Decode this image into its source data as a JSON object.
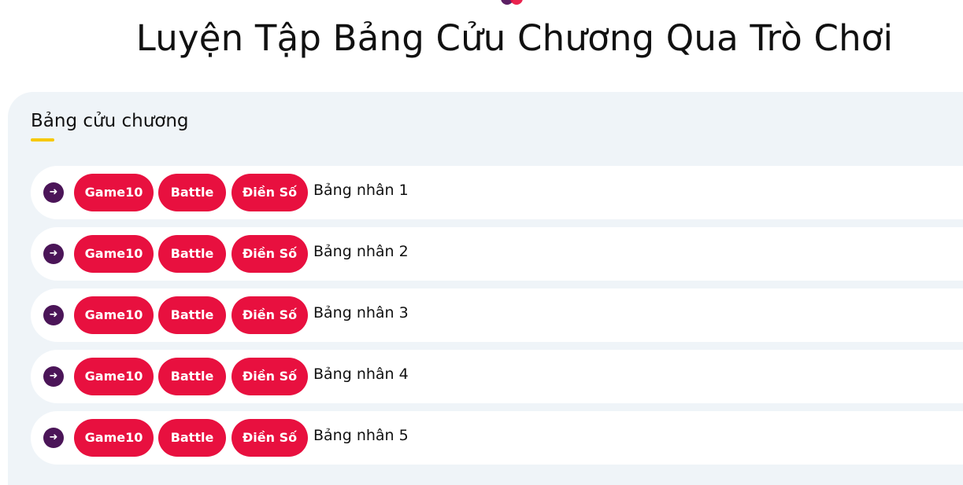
{
  "header": {
    "title": "Luyện Tập Bảng Cửu Chương Qua Trò Chơi"
  },
  "section": {
    "title": "Bảng cửu chương"
  },
  "rows": [
    {
      "game10": "Game10",
      "battle": "Battle",
      "dienso": "Điền Số",
      "label": "Bảng nhân 1"
    },
    {
      "game10": "Game10",
      "battle": "Battle",
      "dienso": "Điền Số",
      "label": "Bảng nhân 2"
    },
    {
      "game10": "Game10",
      "battle": "Battle",
      "dienso": "Điền Số",
      "label": "Bảng nhân 3"
    },
    {
      "game10": "Game10",
      "battle": "Battle",
      "dienso": "Điền Số",
      "label": "Bảng nhân 4"
    },
    {
      "game10": "Game10",
      "battle": "Battle",
      "dienso": "Điền Số",
      "label": "Bảng nhân 5"
    }
  ],
  "icons": {
    "row_arrow": "arrow-right-icon",
    "logo": "logo-dots-icon"
  },
  "colors": {
    "button": "#e8103f",
    "arrow_circle": "#4b1558",
    "underline": "#f7c800",
    "panel": "#eff4f8"
  }
}
